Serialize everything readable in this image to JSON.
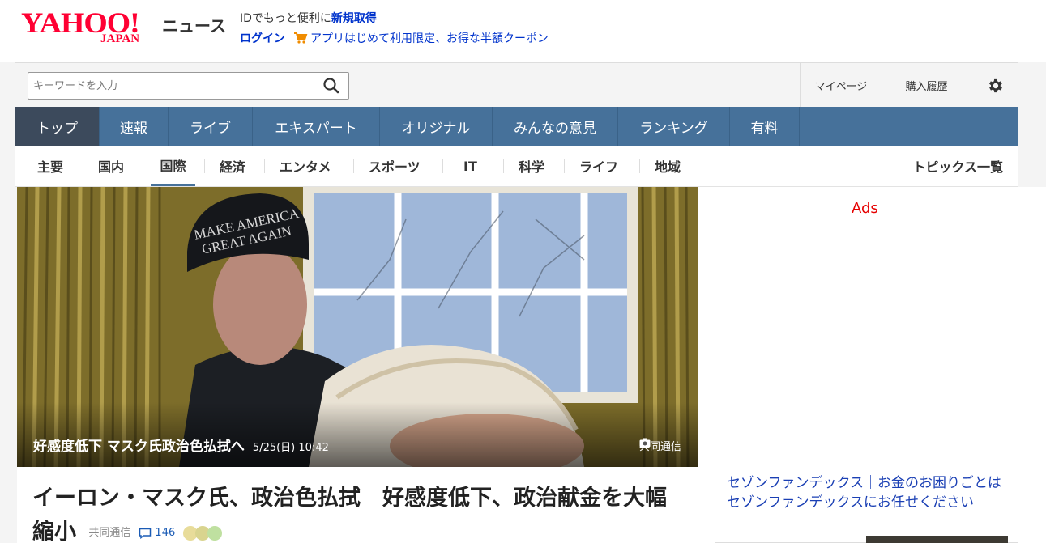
{
  "header": {
    "logo_main": "YAHOO!",
    "logo_sub": "JAPAN",
    "service_name": "ニュース",
    "promo_text": "IDでもっと便利に",
    "signup_link": "新規取得",
    "login_link": "ログイン",
    "coupon_link": "アプリはじめて利用限定、お得な半額クーポン"
  },
  "search": {
    "placeholder": "キーワードを入力",
    "button_icon": "search-icon"
  },
  "utility": {
    "mypage": "マイページ",
    "history": "購入履歴",
    "settings_icon": "gear-icon"
  },
  "main_nav": [
    {
      "label": "トップ",
      "active": true
    },
    {
      "label": "速報",
      "active": false
    },
    {
      "label": "ライブ",
      "active": false
    },
    {
      "label": "エキスパート",
      "active": false
    },
    {
      "label": "オリジナル",
      "active": false
    },
    {
      "label": "みんなの意見",
      "active": false
    },
    {
      "label": "ランキング",
      "active": false
    },
    {
      "label": "有料",
      "active": false
    }
  ],
  "sub_nav": {
    "items": [
      "主要",
      "国内",
      "国際",
      "経済",
      "エンタメ",
      "スポーツ",
      "IT",
      "科学",
      "ライフ",
      "地域"
    ],
    "active": "国際",
    "topics_link": "トピックス一覧"
  },
  "hero": {
    "caption": "好感度低下 マスク氏政治色払拭へ",
    "timestamp": "5/25(日) 10:42",
    "credit": "共同通信",
    "camera_icon": "camera-icon"
  },
  "article": {
    "title": "イーロン・マスク氏、政治色払拭　好感度低下、政治献金を大幅縮小",
    "source": "共同通信",
    "comment_count": "146",
    "comment_icon": "comment-icon"
  },
  "sidebar": {
    "ads_label": "Ads",
    "ad_text": "セゾンファンデックス｜お金のお困りごとはセゾンファンデックスにお任せください"
  },
  "colors": {
    "nav_bg": "#46719a",
    "nav_active": "#3c4a5c",
    "brand_red": "#ff0033",
    "link_blue": "#0033cc"
  }
}
